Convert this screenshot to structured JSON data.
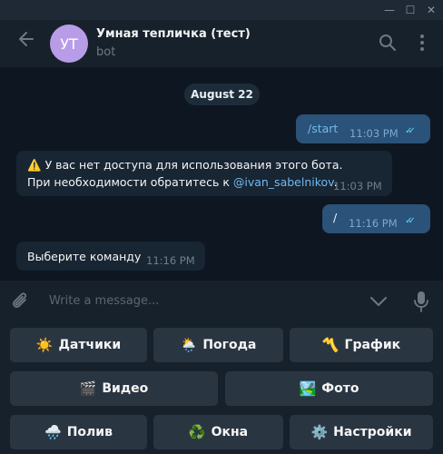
{
  "window": {
    "minimize_glyph": "—",
    "maximize_glyph": "☐",
    "close_glyph": "✕"
  },
  "header": {
    "avatar_initials": "УТ",
    "avatar_color": "#b89ce8",
    "title": "Умная тепличка (тест)",
    "subtitle": "bot",
    "icons": [
      "back-arrow-icon",
      "search-icon",
      "more-vert-icon"
    ]
  },
  "chat": {
    "date": "August 22",
    "messages": [
      {
        "side": "out",
        "text": "/start",
        "time": "11:03 PM",
        "read": true
      },
      {
        "side": "in",
        "warning_emoji": "⚠️",
        "line1": "У вас нет доступа для использования этого бота.",
        "line2_prefix": "При необходимости обратитесь к ",
        "mention": "@ivan_sabelnikov",
        "line2_suffix": ".",
        "time": "11:03 PM"
      },
      {
        "side": "out",
        "text": "/",
        "time": "11:16 PM",
        "read": true
      },
      {
        "side": "in",
        "text": "Выберите команду",
        "time": "11:16 PM"
      }
    ]
  },
  "composer": {
    "placeholder": "Write a message..."
  },
  "keyboard": {
    "rows": [
      [
        {
          "emoji": "☀️",
          "label": "Датчики"
        },
        {
          "emoji": "🌦️",
          "label": "Погода"
        },
        {
          "emoji": "〽️",
          "label": "График"
        }
      ],
      [
        {
          "emoji": "🎬",
          "label": "Видео"
        },
        {
          "emoji": "🏞️",
          "label": "Фото"
        }
      ],
      [
        {
          "emoji": "🌧️",
          "label": "Полив"
        },
        {
          "emoji": "♻️",
          "label": "Окна"
        },
        {
          "emoji": "⚙️",
          "label": "Настройки"
        }
      ]
    ]
  },
  "colors": {
    "background": "#0e1621",
    "panel": "#17212b",
    "outgoing": "#2b5278",
    "incoming": "#182533",
    "accent": "#62d5ff",
    "link": "#71baf2"
  }
}
